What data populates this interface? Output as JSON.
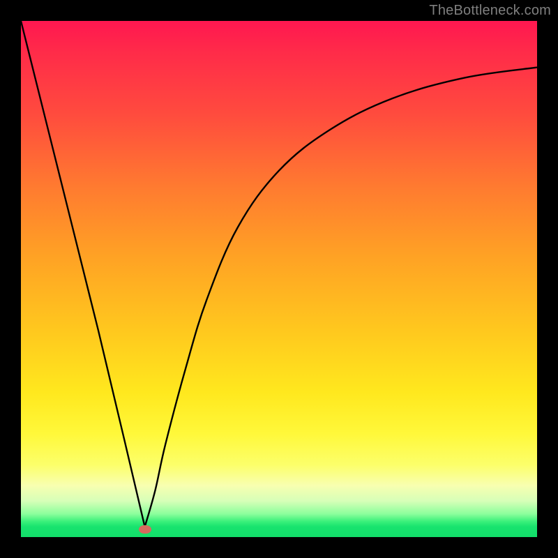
{
  "watermark": "TheBottleneck.com",
  "colors": {
    "frame": "#000000",
    "curve": "#000000",
    "marker": "#d66a5e",
    "watermark_text": "#7f7f7f"
  },
  "chart_data": {
    "type": "line",
    "title": "",
    "xlabel": "",
    "ylabel": "",
    "xlim": [
      0,
      100
    ],
    "ylim": [
      0,
      100
    ],
    "grid": false,
    "legend": false,
    "series": [
      {
        "name": "left-branch",
        "x": [
          0,
          5,
          10,
          15,
          20,
          24
        ],
        "y": [
          100,
          80,
          60,
          40,
          19,
          2
        ]
      },
      {
        "name": "right-branch",
        "x": [
          24,
          26,
          28,
          32,
          36,
          42,
          50,
          60,
          72,
          86,
          100
        ],
        "y": [
          2,
          9,
          18,
          33,
          46,
          60,
          71,
          79,
          85,
          89,
          91
        ]
      }
    ],
    "marker": {
      "x": 24,
      "y": 1.5
    },
    "background_gradient_stops": [
      {
        "pos": 0.0,
        "color": "#ff1750"
      },
      {
        "pos": 0.18,
        "color": "#ff4b3e"
      },
      {
        "pos": 0.46,
        "color": "#ffa324"
      },
      {
        "pos": 0.72,
        "color": "#ffe81e"
      },
      {
        "pos": 0.9,
        "color": "#f8ffb0"
      },
      {
        "pos": 0.97,
        "color": "#39f07a"
      },
      {
        "pos": 1.0,
        "color": "#12df6a"
      }
    ]
  }
}
